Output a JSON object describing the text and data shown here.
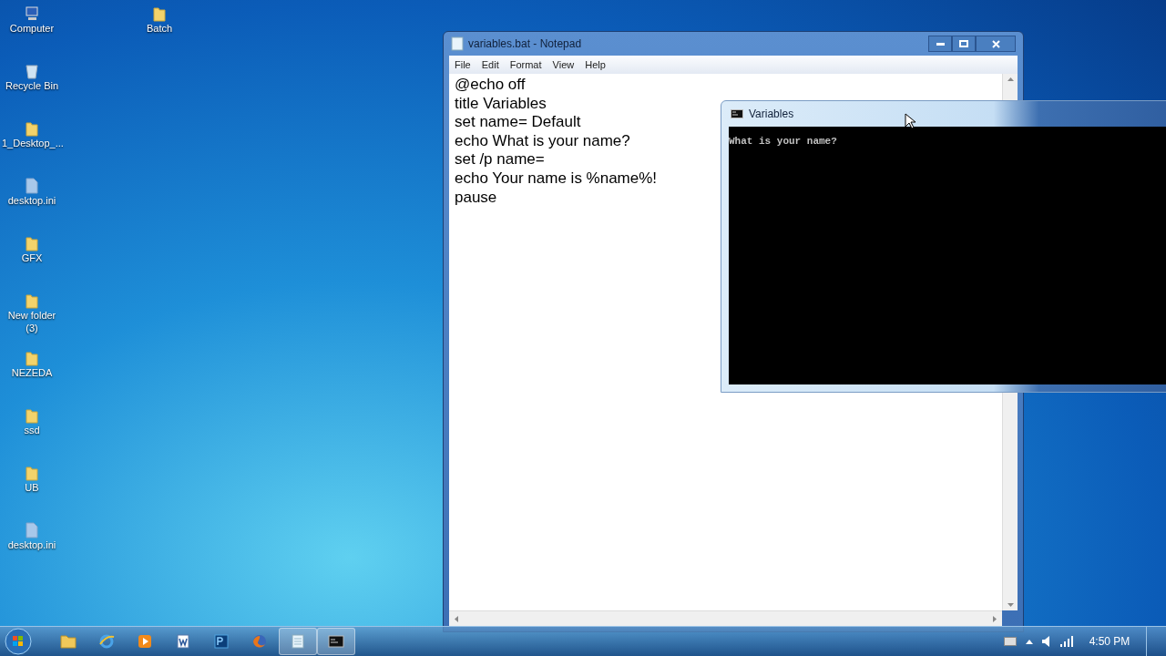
{
  "desktop_icons": [
    {
      "label": "Computer",
      "kind": "computer"
    },
    {
      "label": "Recycle Bin",
      "kind": "recycle_bin"
    },
    {
      "label": "1_Desktop_...",
      "kind": "folder"
    },
    {
      "label": "desktop.ini",
      "kind": "file"
    },
    {
      "label": "GFX",
      "kind": "folder"
    },
    {
      "label": "New folder (3)",
      "kind": "folder"
    },
    {
      "label": "NEZEDA",
      "kind": "folder"
    },
    {
      "label": "ssd",
      "kind": "folder"
    },
    {
      "label": "UB",
      "kind": "folder"
    },
    {
      "label": "desktop.ini",
      "kind": "file"
    }
  ],
  "desktop_icons_column_2": [
    {
      "label": "Batch",
      "kind": "folder"
    }
  ],
  "notepad": {
    "title": "variables.bat - Notepad",
    "menu": [
      "File",
      "Edit",
      "Format",
      "View",
      "Help"
    ],
    "lines": [
      "@echo off",
      "title Variables",
      "set name= Default",
      "echo What is your name?",
      "set /p name=",
      "echo Your name is %name%!",
      "pause"
    ]
  },
  "console": {
    "title": "Variables",
    "output": "What is your name?"
  },
  "taskbar": {
    "items": [
      {
        "kind": "explorer",
        "open": false
      },
      {
        "kind": "browser",
        "open": false
      },
      {
        "kind": "media",
        "open": false
      },
      {
        "kind": "word",
        "open": false
      },
      {
        "kind": "photoshop",
        "open": false
      },
      {
        "kind": "firefox",
        "open": false
      },
      {
        "kind": "notepad",
        "open": true
      },
      {
        "kind": "console",
        "open": true
      }
    ],
    "clock": "4:50 PM"
  }
}
